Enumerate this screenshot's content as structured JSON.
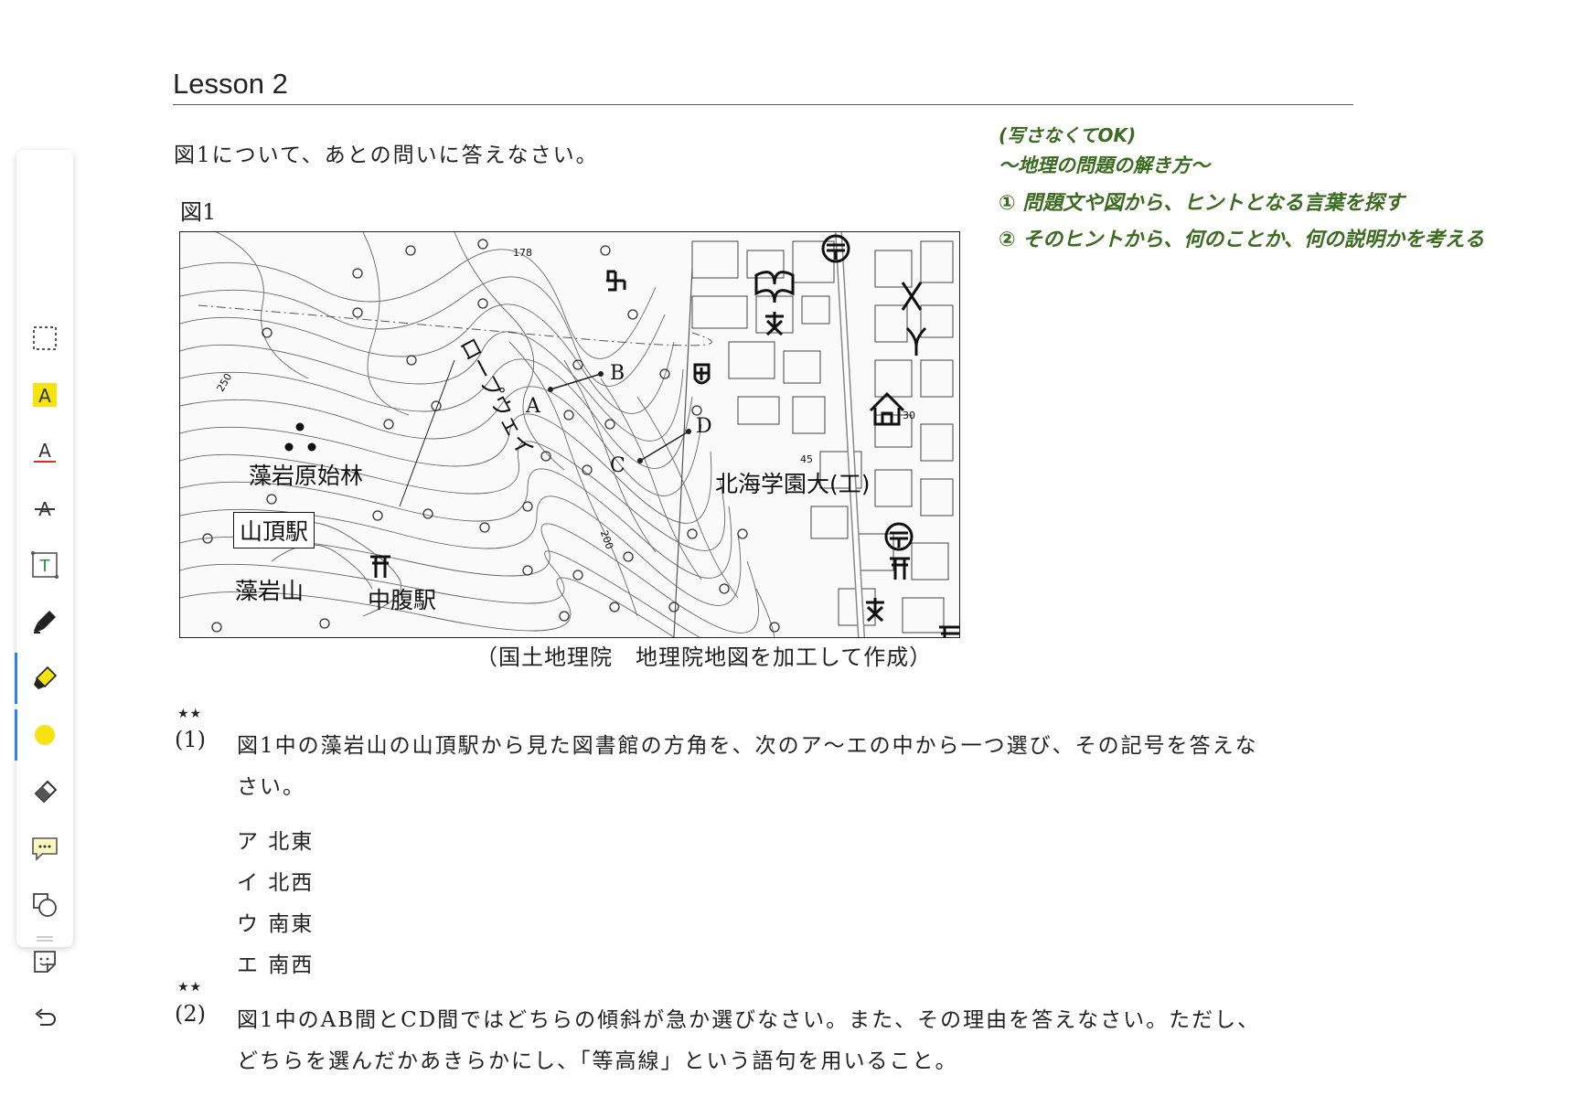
{
  "lesson": {
    "title": "Lesson 2"
  },
  "intro": "図1について、あとの問いに答えなさい。",
  "figure": {
    "label": "図1",
    "map_labels": {
      "ropeway": "ロープウェイ",
      "forest": "藻岩原始林",
      "summit_station": "山頂駅",
      "mountain": "藻岩山",
      "mid_station": "中腹駅",
      "university": "北海学園大(工)",
      "point_a": "A",
      "point_b": "B",
      "point_c": "C",
      "point_d": "D",
      "elev_178": "178",
      "elev_250": "250",
      "elev_200": "200",
      "elev_45": "45",
      "elev_30": "30"
    },
    "caption": "（国土地理院　地理院地図を加工して作成）"
  },
  "notes": [
    "(写さなくてOK)",
    "〜地理の問題の解き方〜",
    "① 問題文や図から、ヒントとなる言葉を探す",
    "② そのヒントから、何のことか、何の説明かを考える"
  ],
  "questions": [
    {
      "stars": "★★",
      "number": "(1)",
      "text_line1": "図1中の藻岩山の山頂駅から見た図書館の方角を、次のア～エの中から一つ選び、その記号を答えな",
      "text_line2": "さい。",
      "options": [
        "ア 北東",
        "イ 北西",
        "ウ 南東",
        "エ 南西"
      ]
    },
    {
      "stars": "★★",
      "number": "(2)",
      "text_line1": "図1中のAB間とCD間ではどちらの傾斜が急か選びなさい。また、その理由を答えなさい。ただし、",
      "text_line2": "どちらを選んだかあきらかにし、「等高線」という語句を用いること。"
    }
  ],
  "toolbar": {
    "tools": [
      "select-tool",
      "highlight-text-tool",
      "underline-tool",
      "strikethrough-tool",
      "text-box-tool",
      "pen-tool",
      "highlighter-tool",
      "color-picker",
      "eraser-tool",
      "comment-tool",
      "shape-tool",
      "sticker-tool",
      "undo-tool"
    ],
    "highlighter_color": "#f5e30f",
    "accent_color": "#2f80ed"
  }
}
